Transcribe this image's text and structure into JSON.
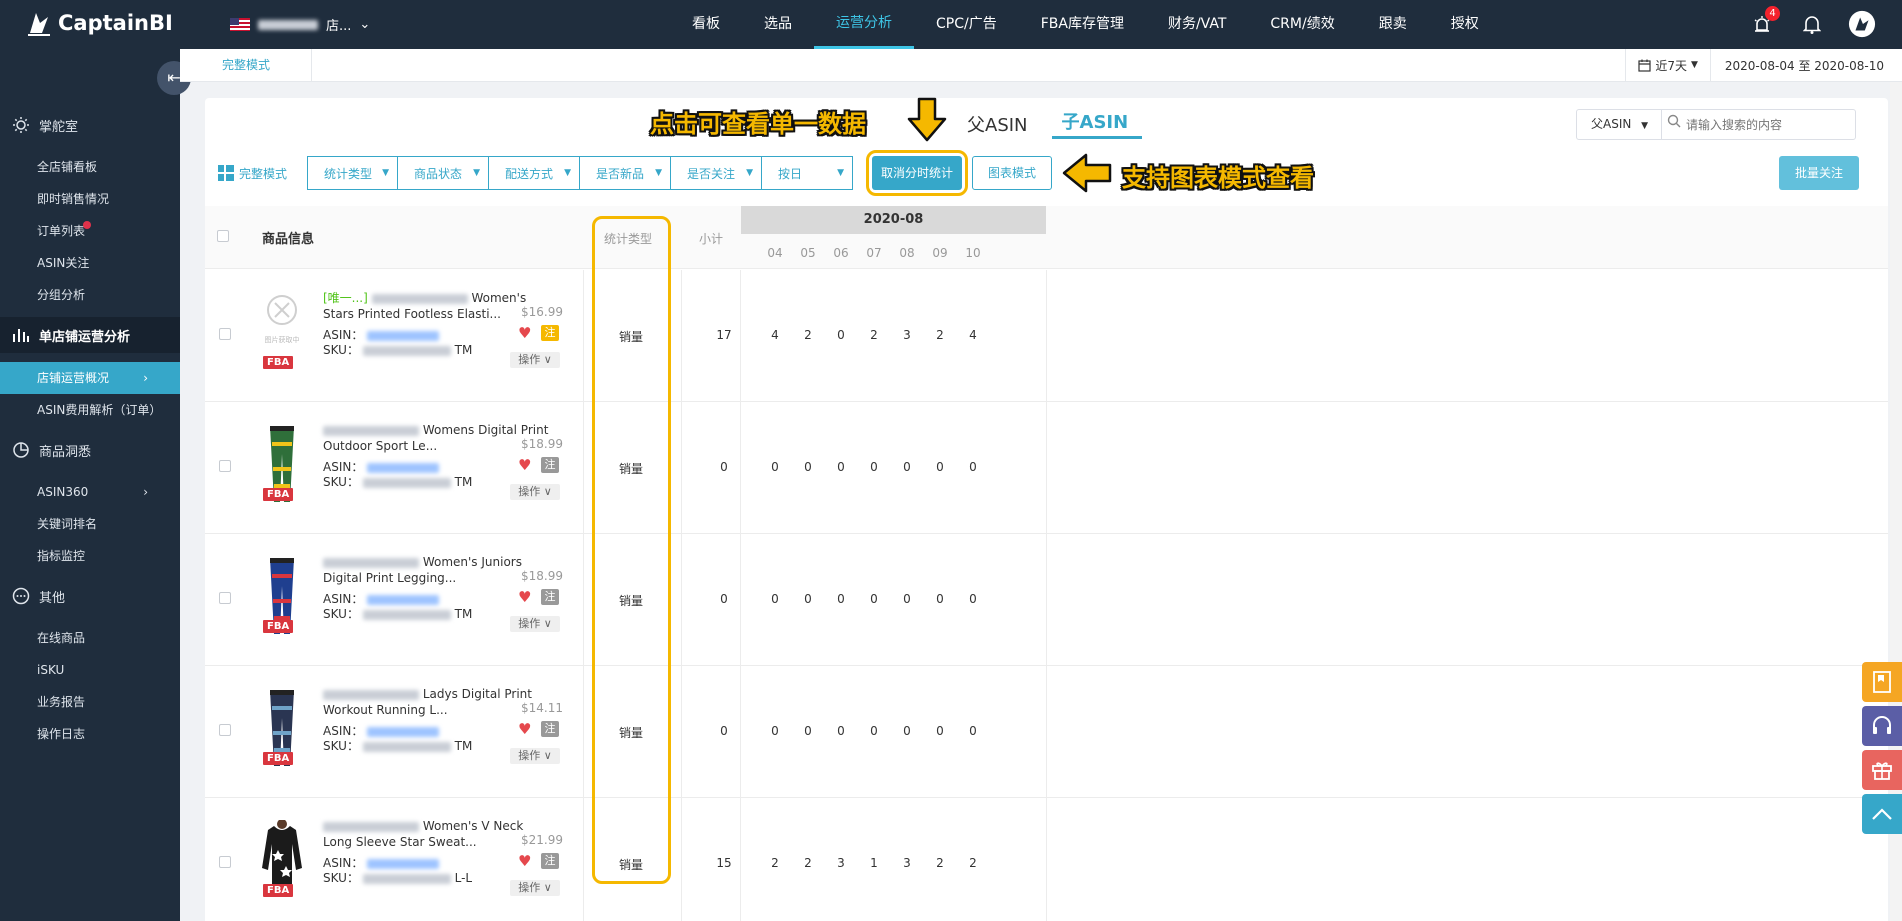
{
  "brand": {
    "name": "CaptainBI"
  },
  "store": {
    "name": "店..."
  },
  "nav": [
    "看板",
    "选品",
    "运营分析",
    "CPC/广告",
    "FBA库存管理",
    "财务/VAT",
    "CRM/绩效",
    "跟卖",
    "授权"
  ],
  "nav_active": "运营分析",
  "alerts": {
    "count": "4"
  },
  "icons": {
    "alert": "alarm-icon",
    "bell": "bell-icon",
    "avatar": "avatar-icon",
    "collapse": "menu-collapse-icon"
  },
  "sidebar": {
    "group1": "掌舵室",
    "group1_items": [
      "全店铺看板",
      "即时销售情况",
      "订单列表",
      "ASIN关注",
      "分组分析"
    ],
    "group2": "单店铺运营分析",
    "group2_items": [
      "店铺运营概况",
      "ASIN费用解析（订单）"
    ],
    "group3": "商品洞悉",
    "group3_items": [
      "ASIN360",
      "关键词排名",
      "指标监控"
    ],
    "group4": "其他",
    "group4_items": [
      "在线商品",
      "iSKU",
      "业务报告",
      "操作日志"
    ]
  },
  "subbar": {
    "mode": "完整模式",
    "period": "近7天",
    "date_range": "2020-08-04 至 2020-08-10"
  },
  "asin_tabs": [
    "父ASIN",
    "子ASIN"
  ],
  "search": {
    "select": "父ASIN",
    "placeholder": "请输入搜索的内容"
  },
  "toolbar": {
    "fullmode": "完整模式",
    "filters": [
      "统计类型",
      "商品状态",
      "配送方式",
      "是否新品",
      "是否关注",
      "按日"
    ],
    "cancel_btn": "取消分时统计",
    "chart_btn": "图表模式",
    "batch_btn": "批量关注"
  },
  "annotations": {
    "note1": "点击可查看单一数据",
    "note2": "支持图表模式查看"
  },
  "table": {
    "header_product": "商品信息",
    "header_type": "统计类型",
    "header_subtotal": "小计",
    "month": "2020-08",
    "days": [
      "04",
      "05",
      "06",
      "07",
      "08",
      "09",
      "10"
    ],
    "rows": [
      {
        "tag": "[唯一...]",
        "title": "Women's Stars Printed Footless Elasti...",
        "price": "$16.99",
        "asin_label": "ASIN：",
        "sku_label": "SKU：",
        "sku_tail": "TM",
        "type": "销量",
        "subtotal": "17",
        "values": [
          "4",
          "2",
          "0",
          "2",
          "3",
          "2",
          "4"
        ],
        "img_missing": true,
        "missing_text": "图片获取中",
        "zhu_yellow": true
      },
      {
        "tag": "",
        "title": "Womens Digital Print Outdoor Sport Le...",
        "price": "$18.99",
        "asin_label": "ASIN：",
        "sku_label": "SKU：",
        "sku_tail": "TM",
        "type": "销量",
        "subtotal": "0",
        "values": [
          "0",
          "0",
          "0",
          "0",
          "0",
          "0",
          "0"
        ],
        "img_missing": false,
        "zhu_yellow": false
      },
      {
        "tag": "",
        "title": "Women's Juniors Digital Print Legging...",
        "price": "$18.99",
        "asin_label": "ASIN：",
        "sku_label": "SKU：",
        "sku_tail": "TM",
        "type": "销量",
        "subtotal": "0",
        "values": [
          "0",
          "0",
          "0",
          "0",
          "0",
          "0",
          "0"
        ],
        "img_missing": false,
        "zhu_yellow": false
      },
      {
        "tag": "",
        "title": "Ladys Digital Print Workout Running L...",
        "price": "$14.11",
        "asin_label": "ASIN：",
        "sku_label": "SKU：",
        "sku_tail": "TM",
        "type": "销量",
        "subtotal": "0",
        "values": [
          "0",
          "0",
          "0",
          "0",
          "0",
          "0",
          "0"
        ],
        "img_missing": false,
        "zhu_yellow": false
      },
      {
        "tag": "",
        "title": "Women's V Neck Long Sleeve Star Sweat...",
        "price": "$21.99",
        "asin_label": "ASIN：",
        "sku_label": "SKU：",
        "sku_tail": "L-L",
        "type": "销量",
        "subtotal": "15",
        "values": [
          "2",
          "2",
          "3",
          "1",
          "3",
          "2",
          "2"
        ],
        "img_missing": false,
        "zhu_yellow": false
      }
    ],
    "fba_label": "FBA",
    "heart_icon": "heart-icon",
    "zhu_label": "注",
    "op_label": "操作 ∨"
  },
  "colors": {
    "accent": "#36a7c9",
    "sidebar": "#1f2d3d",
    "note": "#f5b800",
    "fba": "#d9363e"
  }
}
